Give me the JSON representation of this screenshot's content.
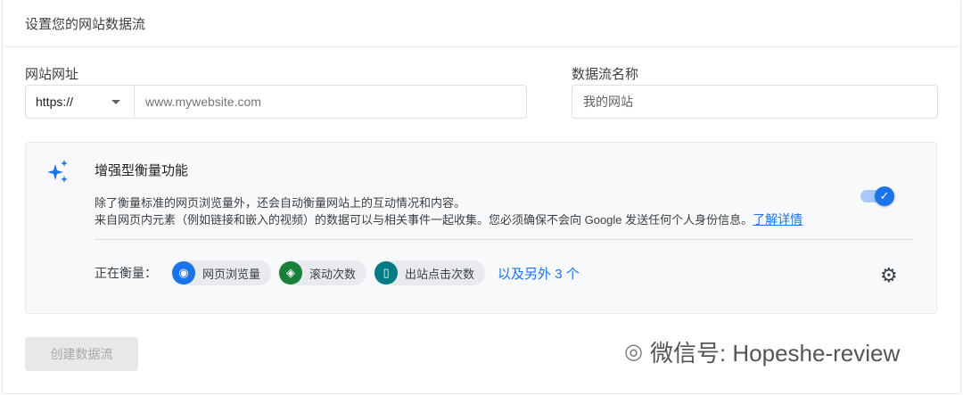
{
  "header": {
    "title": "设置您的网站数据流"
  },
  "url_field": {
    "label": "网站网址",
    "protocol": "https://",
    "placeholder": "www.mywebsite.com"
  },
  "stream_name": {
    "label": "数据流名称",
    "placeholder": "我的网站"
  },
  "enhanced": {
    "title": "增强型衡量功能",
    "desc1": "除了衡量标准的网页浏览量外，还会自动衡量网站上的互动情况和内容。",
    "desc2": "来自网页内元素（例如链接和嵌入的视频）的数据可以与相关事件一起收集。您必须确保不会向 Google 发送任何个人身份信息。",
    "learn_more": "了解详情",
    "toggle_on": true,
    "measuring_label": "正在衡量：",
    "chips": [
      {
        "label": "网页浏览量",
        "color": "#1a73e8"
      },
      {
        "label": "滚动次数",
        "color": "#188038"
      },
      {
        "label": "出站点击次数",
        "color": "#007b83"
      }
    ],
    "more": "以及另外 3 个"
  },
  "create_button": "创建数据流",
  "watermark": "微信号: Hopeshe-review"
}
